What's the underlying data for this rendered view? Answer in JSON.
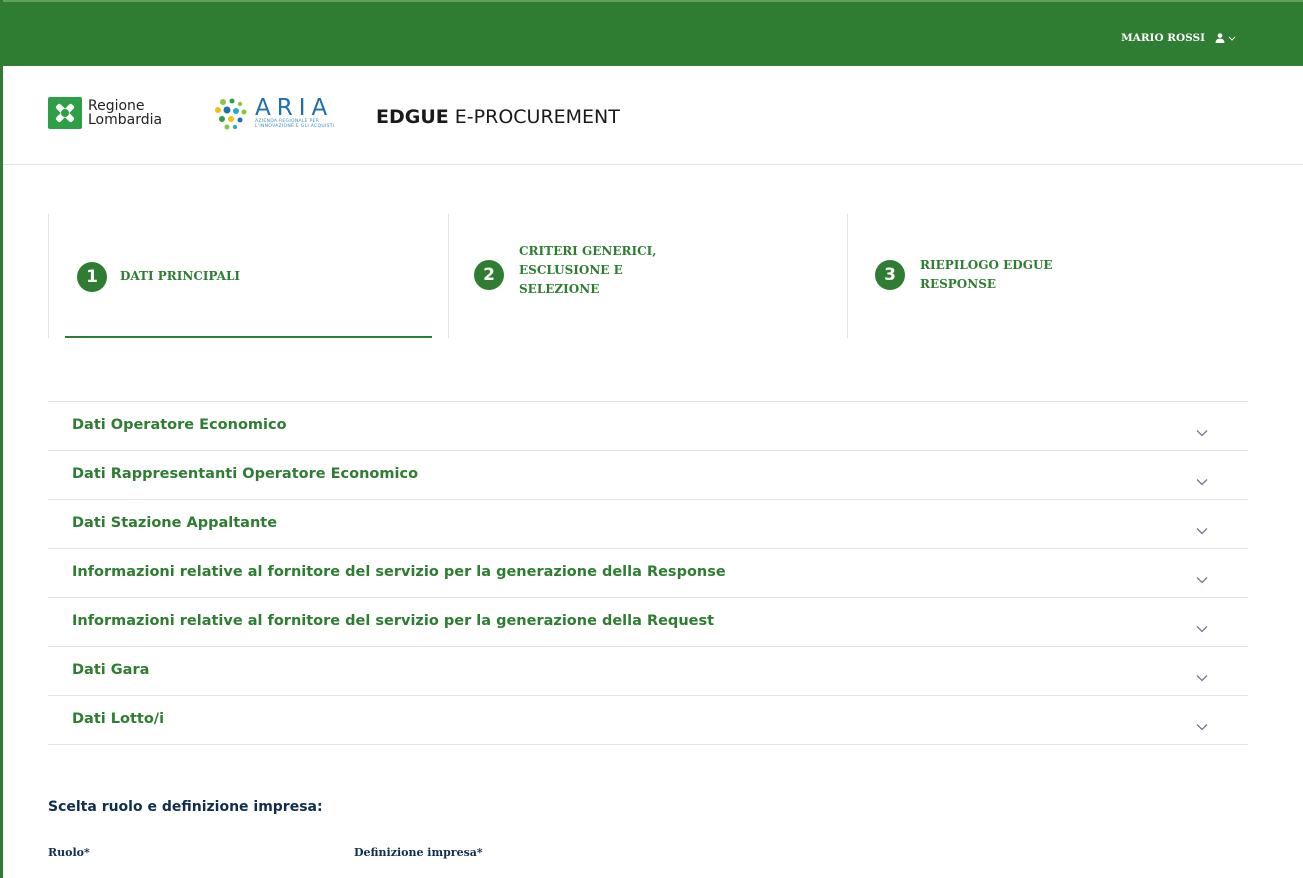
{
  "user": {
    "name": "MARIO ROSSI"
  },
  "header": {
    "regione_line1": "Regione",
    "regione_line2": "Lombardia",
    "aria_word": "ARIA",
    "aria_sub1": "AZIENDA REGIONALE PER",
    "aria_sub2": "L'INNOVAZIONE E GLI ACQUISTI",
    "brand_bold": "EDGUE",
    "brand_rest": " E-PROCUREMENT"
  },
  "steps": [
    {
      "number": "1",
      "label": "DATI PRINCIPALI",
      "active": true
    },
    {
      "number": "2",
      "label": "CRITERI GENERICI, ESCLUSIONE E SELEZIONE",
      "active": false
    },
    {
      "number": "3",
      "label": "RIEPILOGO EDGUE RESPONSE",
      "active": false
    }
  ],
  "accordion": [
    "Dati Operatore Economico",
    "Dati Rappresentanti Operatore Economico",
    "Dati Stazione Appaltante",
    "Informazioni relative al fornitore del servizio per la generazione della Response",
    "Informazioni relative al fornitore del servizio per la generazione della Request",
    "Dati Gara",
    "Dati Lotto/i"
  ],
  "form": {
    "section_title": "Scelta ruolo e definizione impresa:",
    "ruolo_label": "Ruolo*",
    "definizione_label": "Definizione impresa*"
  },
  "colors": {
    "primary": "#2e7d32",
    "text_dark": "#0f2e4f",
    "aria_blue": "#1e6fb0"
  },
  "icons": {
    "user": "user-icon",
    "chevron": "chevron-down-icon"
  }
}
